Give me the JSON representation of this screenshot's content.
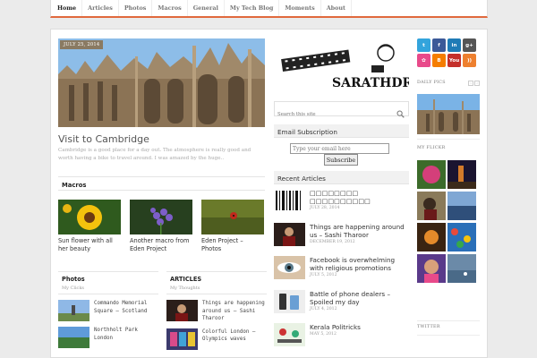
{
  "nav": {
    "items": [
      "Home",
      "Articles",
      "Photos",
      "Macros",
      "General",
      "My Tech Blog",
      "Moments",
      "About"
    ],
    "active": "Home"
  },
  "featured": {
    "date": "JULY 25, 2014",
    "title": "Visit to Cambridge",
    "excerpt": "Cambridge is a good place for a day out. The atmosphere is really good and worth having a bike to travel around. I was amazed by the huge.."
  },
  "macros": {
    "heading": "Macros",
    "items": [
      {
        "caption": "Sun flower with all her beauty",
        "icon": "sunflower-photo"
      },
      {
        "caption": "Another macro from Eden Project",
        "icon": "purple-flower-photo"
      },
      {
        "caption": "Eden Project – Photos",
        "icon": "ladybird-photo"
      }
    ]
  },
  "photos": {
    "title": "Photos",
    "subtitle": "My Clicks",
    "items": [
      "Commando Memorial Square – Scotland",
      "Northholt Park London"
    ]
  },
  "articles": {
    "title": "ARTICLES",
    "subtitle": "My Thoughts",
    "items": [
      "Things are happening around us – Sashi Tharoor",
      "Colorful London – Olympics waves"
    ]
  },
  "logo": {
    "text": "SARATHDR"
  },
  "search": {
    "placeholder": "Search this site"
  },
  "email_widget": {
    "heading": "Email Subscription",
    "placeholder": "Type your email here",
    "button": "Subscribe"
  },
  "recent": {
    "heading": "Recent Articles",
    "items": [
      {
        "title": "□□□□□□□□ □□□□□□□□□□",
        "date": "JULY 28, 2014"
      },
      {
        "title": "Things are happening around us – Sashi Tharoor",
        "date": "DECEMBER 19, 2012"
      },
      {
        "title": "Facebook is overwhelming with religious promotions",
        "date": "JULY 5, 2012"
      },
      {
        "title": "Battle of phone dealers – Spoiled my day",
        "date": "JULY 4, 2012"
      },
      {
        "title": "Kerala Politricks",
        "date": "MAY 5, 2012"
      }
    ]
  },
  "social": {
    "icons": [
      {
        "label": "t",
        "color": "#33a4dc",
        "name": "twitter-icon"
      },
      {
        "label": "f",
        "color": "#3b5998",
        "name": "facebook-icon"
      },
      {
        "label": "in",
        "color": "#1f7bb6",
        "name": "linkedin-icon"
      },
      {
        "label": "g+",
        "color": "#555555",
        "name": "google-plus-icon"
      },
      {
        "label": "✿",
        "color": "#e84a8a",
        "name": "flickr-icon"
      },
      {
        "label": "B",
        "color": "#f57d00",
        "name": "blogger-icon"
      },
      {
        "label": "You",
        "color": "#c4302b",
        "name": "youtube-icon"
      },
      {
        "label": "))",
        "color": "#ee802f",
        "name": "rss-icon"
      }
    ]
  },
  "sidebar": {
    "daily_pics": "DAILY PICS",
    "my_flickr": "MY FLICKR",
    "twitter": "TWITTER"
  },
  "colors": {
    "accent": "#e0693d",
    "badge": "#8a7a62"
  }
}
